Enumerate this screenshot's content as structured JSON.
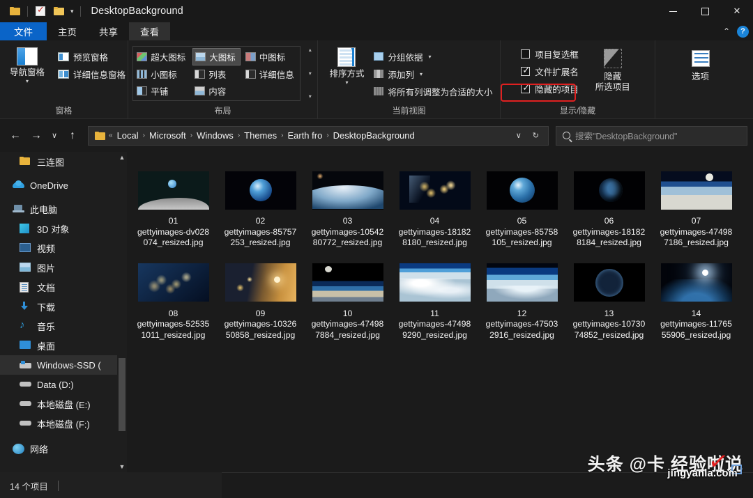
{
  "window": {
    "title": "DesktopBackground",
    "quick_access": [
      "folder-icon",
      "properties-icon",
      "new-folder-icon",
      "customize-caret"
    ],
    "controls": {
      "minimize": "–",
      "maximize": "□",
      "close": "✕"
    },
    "ribbon_collapse": "⌃",
    "help": "?"
  },
  "tabs": [
    {
      "label": "文件",
      "state": "file"
    },
    {
      "label": "主页",
      "state": "normal"
    },
    {
      "label": "共享",
      "state": "normal"
    },
    {
      "label": "查看",
      "state": "active"
    }
  ],
  "ribbon": {
    "groups": [
      {
        "name": "窗格",
        "big_button": {
          "label": "导航窗格",
          "has_caret": true
        },
        "items": [
          {
            "label": "预览窗格"
          },
          {
            "label": "详细信息窗格"
          }
        ]
      },
      {
        "name": "布局",
        "layout_options": [
          {
            "label": "超大图标",
            "selected": false
          },
          {
            "label": "大图标",
            "selected": true
          },
          {
            "label": "中图标",
            "selected": false
          },
          {
            "label": "小图标",
            "selected": false
          },
          {
            "label": "列表",
            "selected": false
          },
          {
            "label": "详细信息",
            "selected": false
          },
          {
            "label": "平铺",
            "selected": false
          },
          {
            "label": "内容",
            "selected": false
          }
        ]
      },
      {
        "name": "当前视图",
        "big_button": {
          "label": "排序方式",
          "has_caret": true
        },
        "items": [
          {
            "label": "分组依据",
            "has_caret": true
          },
          {
            "label": "添加列",
            "has_caret": true
          },
          {
            "label": "将所有列调整为合适的大小",
            "has_caret": false
          }
        ]
      },
      {
        "name": "显示/隐藏",
        "checkboxes": [
          {
            "label": "项目复选框",
            "checked": false,
            "highlighted": false
          },
          {
            "label": "文件扩展名",
            "checked": true,
            "highlighted": false
          },
          {
            "label": "隐藏的项目",
            "checked": true,
            "highlighted": true
          }
        ],
        "big_button": {
          "label_line1": "隐藏",
          "label_line2": "所选项目"
        }
      },
      {
        "name": "",
        "big_button": {
          "label": "选项"
        }
      }
    ],
    "highlight_color": "#e02020"
  },
  "address_bar": {
    "back": "←",
    "forward": "→",
    "recent": "∨",
    "up": "↑",
    "folder_icon": "folder-icon",
    "overflow": "«",
    "crumbs": [
      "Local",
      "Microsoft",
      "Windows",
      "Themes",
      "Earth fro",
      "DesktopBackground"
    ],
    "separator": "›",
    "dropdown": "∨",
    "refresh": "↻",
    "search_placeholder": "搜索\"DesktopBackground\""
  },
  "sidebar": {
    "items": [
      {
        "label": "三连图",
        "icon": "folder-icon",
        "indent": true,
        "selected": false
      },
      {
        "label": "OneDrive",
        "icon": "cloud-icon",
        "indent": false,
        "selected": false
      },
      {
        "label": "此电脑",
        "icon": "computer-icon",
        "indent": false,
        "selected": false
      },
      {
        "label": "3D 对象",
        "icon": "cube-icon",
        "indent": true,
        "selected": false
      },
      {
        "label": "视频",
        "icon": "video-icon",
        "indent": true,
        "selected": false
      },
      {
        "label": "图片",
        "icon": "picture-icon",
        "indent": true,
        "selected": false
      },
      {
        "label": "文档",
        "icon": "document-icon",
        "indent": true,
        "selected": false
      },
      {
        "label": "下载",
        "icon": "download-icon",
        "indent": true,
        "selected": false
      },
      {
        "label": "音乐",
        "icon": "music-icon",
        "indent": true,
        "selected": false
      },
      {
        "label": "桌面",
        "icon": "desktop-icon",
        "indent": true,
        "selected": false
      },
      {
        "label": "Windows-SSD (",
        "icon": "ssd-icon",
        "indent": true,
        "selected": true
      },
      {
        "label": "Data (D:)",
        "icon": "disk-icon",
        "indent": true,
        "selected": false
      },
      {
        "label": "本地磁盘 (E:)",
        "icon": "disk-icon",
        "indent": true,
        "selected": false
      },
      {
        "label": "本地磁盘 (F:)",
        "icon": "disk-icon",
        "indent": true,
        "selected": false
      },
      {
        "label": "网络",
        "icon": "network-icon",
        "indent": false,
        "selected": false
      }
    ]
  },
  "files": [
    {
      "index": "01",
      "name": "gettyimages-dv028074_resized.jpg",
      "art": "t-earthrise"
    },
    {
      "index": "02",
      "name": "gettyimages-85757253_resized.jpg",
      "art": "t-globe"
    },
    {
      "index": "03",
      "name": "gettyimages-1054280772_resized.jpg",
      "art": "t-storm"
    },
    {
      "index": "04",
      "name": "gettyimages-181828180_resized.jpg",
      "art": "t-usnight"
    },
    {
      "index": "05",
      "name": "gettyimages-85758105_resized.jpg",
      "art": "t-americas"
    },
    {
      "index": "06",
      "name": "gettyimages-181828184_resized.jpg",
      "art": "t-darkglobe"
    },
    {
      "index": "07",
      "name": "gettyimages-474987186_resized.jpg",
      "art": "t-moonhorizon"
    },
    {
      "index": "08",
      "name": "gettyimages-525351011_resized.jpg",
      "art": "t-eunight"
    },
    {
      "index": "09",
      "name": "gettyimages-1032650858_resized.jpg",
      "art": "t-sunrise"
    },
    {
      "index": "10",
      "name": "gettyimages-474987884_resized.jpg",
      "art": "t-moonspace"
    },
    {
      "index": "11",
      "name": "gettyimages-474989290_resized.jpg",
      "art": "t-icecloud"
    },
    {
      "index": "12",
      "name": "gettyimages-475032916_resized.jpg",
      "art": "t-limb"
    },
    {
      "index": "13",
      "name": "gettyimages-1073074852_resized.jpg",
      "art": "t-nightglobe"
    },
    {
      "index": "14",
      "name": "gettyimages-1176555906_resized.jpg",
      "art": "t-sunflare"
    }
  ],
  "status_bar": {
    "item_count": "14 个项目"
  },
  "watermark": {
    "main": "头条 @卡 经验啦说",
    "sub": "jingyanla.com"
  }
}
